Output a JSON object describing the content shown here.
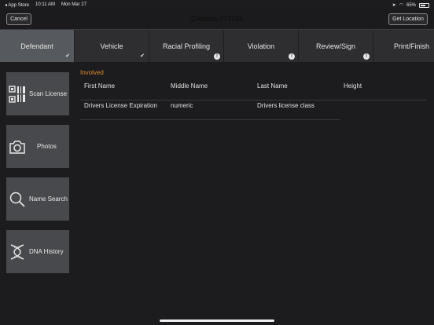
{
  "status": {
    "back_app": "◂ App Store",
    "time": "10:11 AM",
    "date": "Mon Mar 27",
    "battery_text": "65%",
    "battery_level": 0.65
  },
  "navbar": {
    "cancel": "Cancel",
    "title": "Citation #T1736",
    "get_location": "Get Location"
  },
  "tabs": [
    {
      "label": "Defendant",
      "status": "check",
      "active": true
    },
    {
      "label": "Vehicle",
      "status": "check",
      "active": false
    },
    {
      "label": "Racial Profiling",
      "status": "alert",
      "active": false
    },
    {
      "label": "Violation",
      "status": "alert",
      "active": false
    },
    {
      "label": "Review/Sign",
      "status": "alert",
      "active": false
    },
    {
      "label": "Print/Finish",
      "status": "",
      "active": false
    }
  ],
  "sidebar": {
    "scan": "Scan License",
    "photos": "Photos",
    "name_search": "Name Search",
    "dna": "DNA History"
  },
  "main": {
    "section": "Involved",
    "row1": [
      "First Name",
      "Middle Name",
      "Last Name",
      "Height"
    ],
    "row2": [
      "Drivers License Expiration",
      "numeric",
      "Drivers license class"
    ]
  }
}
